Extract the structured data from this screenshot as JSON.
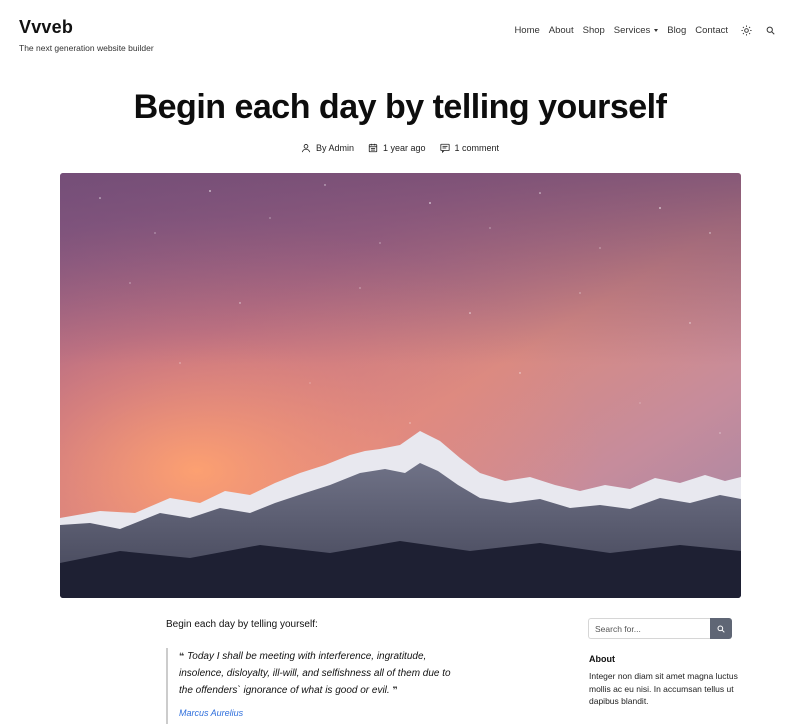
{
  "site": {
    "name": "Vvveb",
    "tagline": "The next generation website builder"
  },
  "nav": {
    "items": [
      "Home",
      "About",
      "Shop",
      "Services",
      "Blog",
      "Contact"
    ]
  },
  "post": {
    "title": "Begin each day by telling yourself",
    "author": "By Admin",
    "date": "1 year ago",
    "comments": "1 comment",
    "hero_alt": "Snowy mountain range under a starry pink and orange sky",
    "lead": "Begin each day by telling yourself:",
    "quote": "Today I shall be meeting with interference, ingratitude, insolence, disloyalty, ill-will, and selfishness all of them due to the offenders` ignorance of what is good or evil.",
    "quote_author": "Marcus Aurelius"
  },
  "sidebar": {
    "search_placeholder": "Search for...",
    "about_title": "About",
    "about_text": "Integer non diam sit amet magna luctus mollis ac eu nisi. In accumsan tellus ut dapibus blandit."
  },
  "colors": {
    "accent_link": "#2f6fdc",
    "search_button": "#5f6675"
  }
}
